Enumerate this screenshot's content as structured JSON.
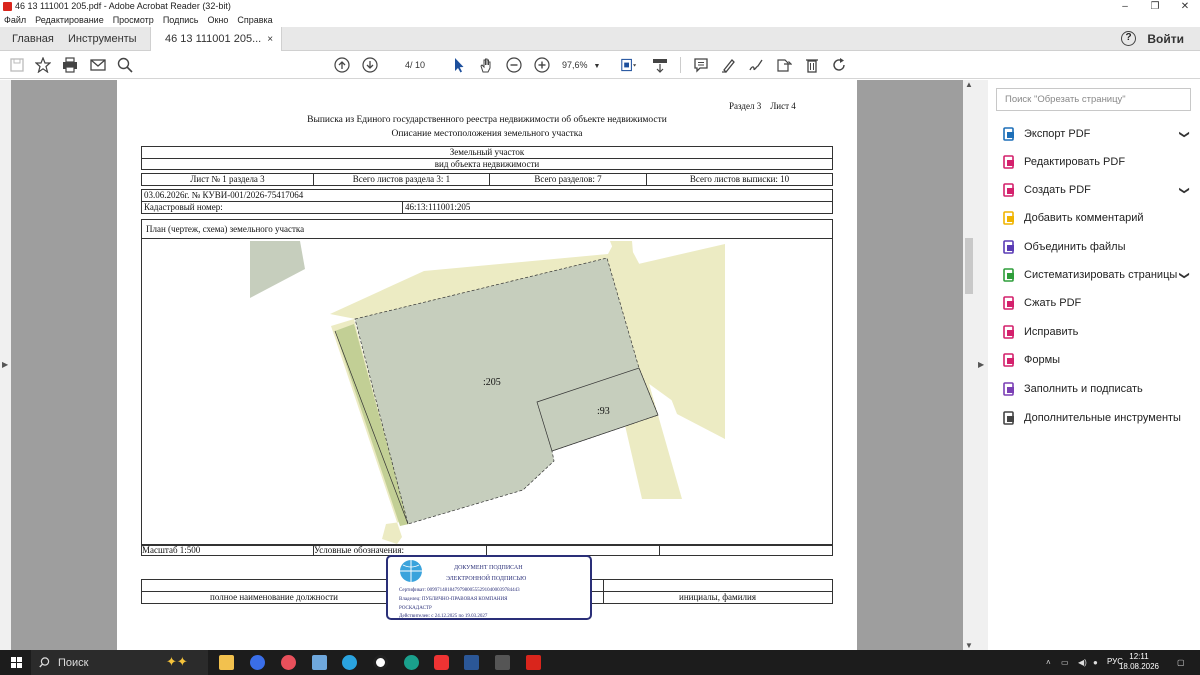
{
  "window": {
    "title": "46 13 111001 205.pdf - Adobe Acrobat Reader (32-bit)",
    "min": "–",
    "max": "❐",
    "close": "✕"
  },
  "menu": [
    "Файл",
    "Редактирование",
    "Просмотр",
    "Подпись",
    "Окно",
    "Справка"
  ],
  "tabs": {
    "home": "Главная",
    "tools": "Инструменты",
    "doc": "46 13 111001 205...",
    "close": "×",
    "help": "?",
    "signin": "Войти"
  },
  "toolbar": {
    "page_current": "4",
    "page_total": "/ 10",
    "zoom": "97,6%"
  },
  "doc": {
    "section": "Раздел 3    Лист 4",
    "title": "Выписка из Единого государственного реестра недвижимости об объекте недвижимости",
    "subtitle": "Описание местоположения земельного участка",
    "object_type": "Земельный участок",
    "object_type_caption": "вид объекта недвижимости",
    "sheet_no": "Лист № 1 раздела 3",
    "sheets_in_section": "Всего листов раздела 3: 1",
    "sections_total": "Всего разделов: 7",
    "sheets_total": "Всего листов выписки: 10",
    "date_no": "03.06.2026г. № КУВИ-001/2026-75417064",
    "cadastral_label": "Кадастровый номер:",
    "cadastral_value": "46:13:111001:205",
    "plan_title": "План (чертеж, схема) земельного участка",
    "parcel_main": ":205",
    "parcel_adj": ":93",
    "scale": "Масштаб 1:500",
    "legend": "Условные обозначения:",
    "position_caption": "полное наименование должности",
    "initials_caption": "инициалы, фамилия",
    "stamp": {
      "line1": "ДОКУМЕНТ ПОДПИСАН",
      "line2": "ЭЛЕКТРОННОЙ ПОДПИСЬЮ",
      "cert": "Сертификат: 0099714818479798005552910400039784443",
      "owner1": "Владелец: ПУБЛИЧНО-ПРАВОВАЯ КОМПАНИЯ",
      "owner2": "РОСКАДАСТР",
      "valid": "Действителен: с 24.12.2025 по 19.03.2027"
    }
  },
  "right_panel": {
    "search_placeholder": "Поиск \"Обрезать страницу\"",
    "tools": [
      {
        "label": "Экспорт PDF",
        "color": "#1d6fb8",
        "icon": "export-pdf-icon"
      },
      {
        "label": "Редактировать PDF",
        "color": "#d4206c",
        "icon": "edit-pdf-icon"
      },
      {
        "label": "Создать PDF",
        "color": "#d4206c",
        "icon": "create-pdf-icon"
      },
      {
        "label": "Добавить комментарий",
        "color": "#f0b400",
        "icon": "comment-icon"
      },
      {
        "label": "Объединить файлы",
        "color": "#5a3bb5",
        "icon": "combine-files-icon"
      },
      {
        "label": "Систематизировать страницы",
        "color": "#2e9e3a",
        "icon": "organize-pages-icon"
      },
      {
        "label": "Сжать PDF",
        "color": "#d4206c",
        "icon": "compress-pdf-icon"
      },
      {
        "label": "Исправить",
        "color": "#d4206c",
        "icon": "redact-icon"
      },
      {
        "label": "Формы",
        "color": "#d4206c",
        "icon": "forms-icon"
      },
      {
        "label": "Заполнить и подписать",
        "color": "#7b3fb5",
        "icon": "fill-sign-icon"
      },
      {
        "label": "Дополнительные инструменты",
        "color": "#444444",
        "icon": "more-tools-icon"
      }
    ]
  },
  "taskbar": {
    "search": "Поиск",
    "lang": "РУС",
    "time": "12:11",
    "date": "18.08.2026"
  }
}
